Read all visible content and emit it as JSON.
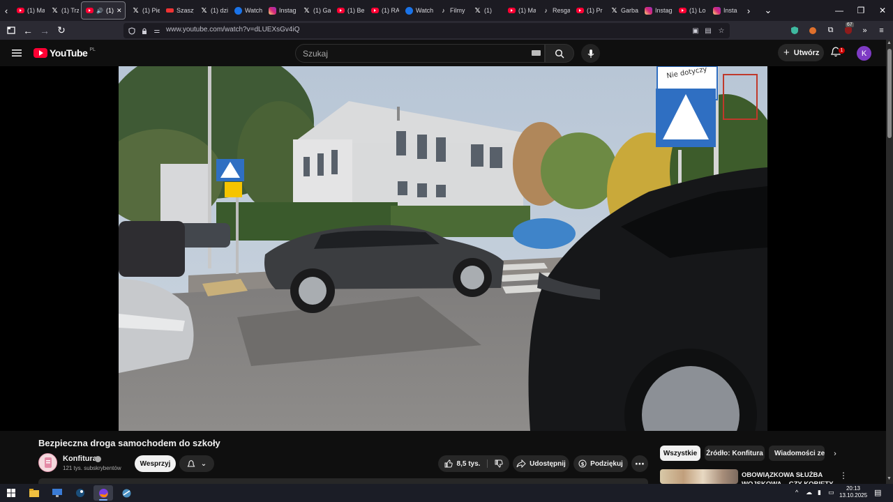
{
  "browser": {
    "tabs": [
      {
        "icon": "youtube-icon",
        "label": "(1) Ma"
      },
      {
        "icon": "x-icon",
        "label": "(1) Trz"
      },
      {
        "icon": "youtube-icon",
        "label": "(1)",
        "active": true
      },
      {
        "icon": "x-icon",
        "label": "(1) Pie"
      },
      {
        "icon": "page-icon",
        "label": "Szaszy"
      },
      {
        "icon": "x-icon",
        "label": "(1) dzi"
      },
      {
        "icon": "watch-icon",
        "label": "Watch"
      },
      {
        "icon": "instagram-icon",
        "label": "Instag"
      },
      {
        "icon": "x-icon",
        "label": "(1) Ga"
      },
      {
        "icon": "youtube-icon",
        "label": "(1) Be"
      },
      {
        "icon": "youtube-icon",
        "label": "(1) RA"
      },
      {
        "icon": "watch-icon",
        "label": "Watch"
      },
      {
        "icon": "tiktok-icon",
        "label": "Filmy"
      },
      {
        "icon": "x-icon",
        "label": "(1)"
      },
      {
        "icon": "youtube-icon",
        "label": "(1) Ma"
      },
      {
        "icon": "tiktok-icon",
        "label": "Resga"
      },
      {
        "icon": "youtube-icon",
        "label": "(1) Pr"
      },
      {
        "icon": "x-icon",
        "label": "Garba"
      },
      {
        "icon": "instagram-icon",
        "label": "Instag"
      },
      {
        "icon": "youtube-icon",
        "label": "(1) Lo"
      },
      {
        "icon": "instagram-icon",
        "label": "Insta"
      }
    ],
    "url": "www.youtube.com/watch?v=dLUEXsGv4iQ",
    "extension_badge": "67"
  },
  "youtube": {
    "logo_text": "YouTube",
    "country": "PL",
    "search_placeholder": "Szukaj",
    "create_label": "Utwórz",
    "notification_count": "1",
    "avatar_letter": "K"
  },
  "video": {
    "title": "Bezpieczna droga samochodem do szkoły",
    "channel_name": "Konfitura",
    "subscribers": "121 tys. subskrybentów",
    "join_label": "Wesprzyj",
    "likes": "8,5 tys.",
    "share_label": "Udostępnij",
    "thanks_label": "Podziękuj",
    "sign_text": "Nie dotyczy"
  },
  "sidebar": {
    "chips": [
      "Wszystkie",
      "Źródło: Konfitura",
      "Wiadomości ze"
    ],
    "related_title": "OBOWIĄZKOWA SŁUŻBA WOJSKOWA – CZY KOBIETY"
  },
  "taskbar": {
    "time": "20:13",
    "date": "13.10.2025"
  },
  "colors": {
    "brand_red": "#ff0033",
    "background": "#0f0f0f",
    "chip_active": "#f1f1f1"
  }
}
